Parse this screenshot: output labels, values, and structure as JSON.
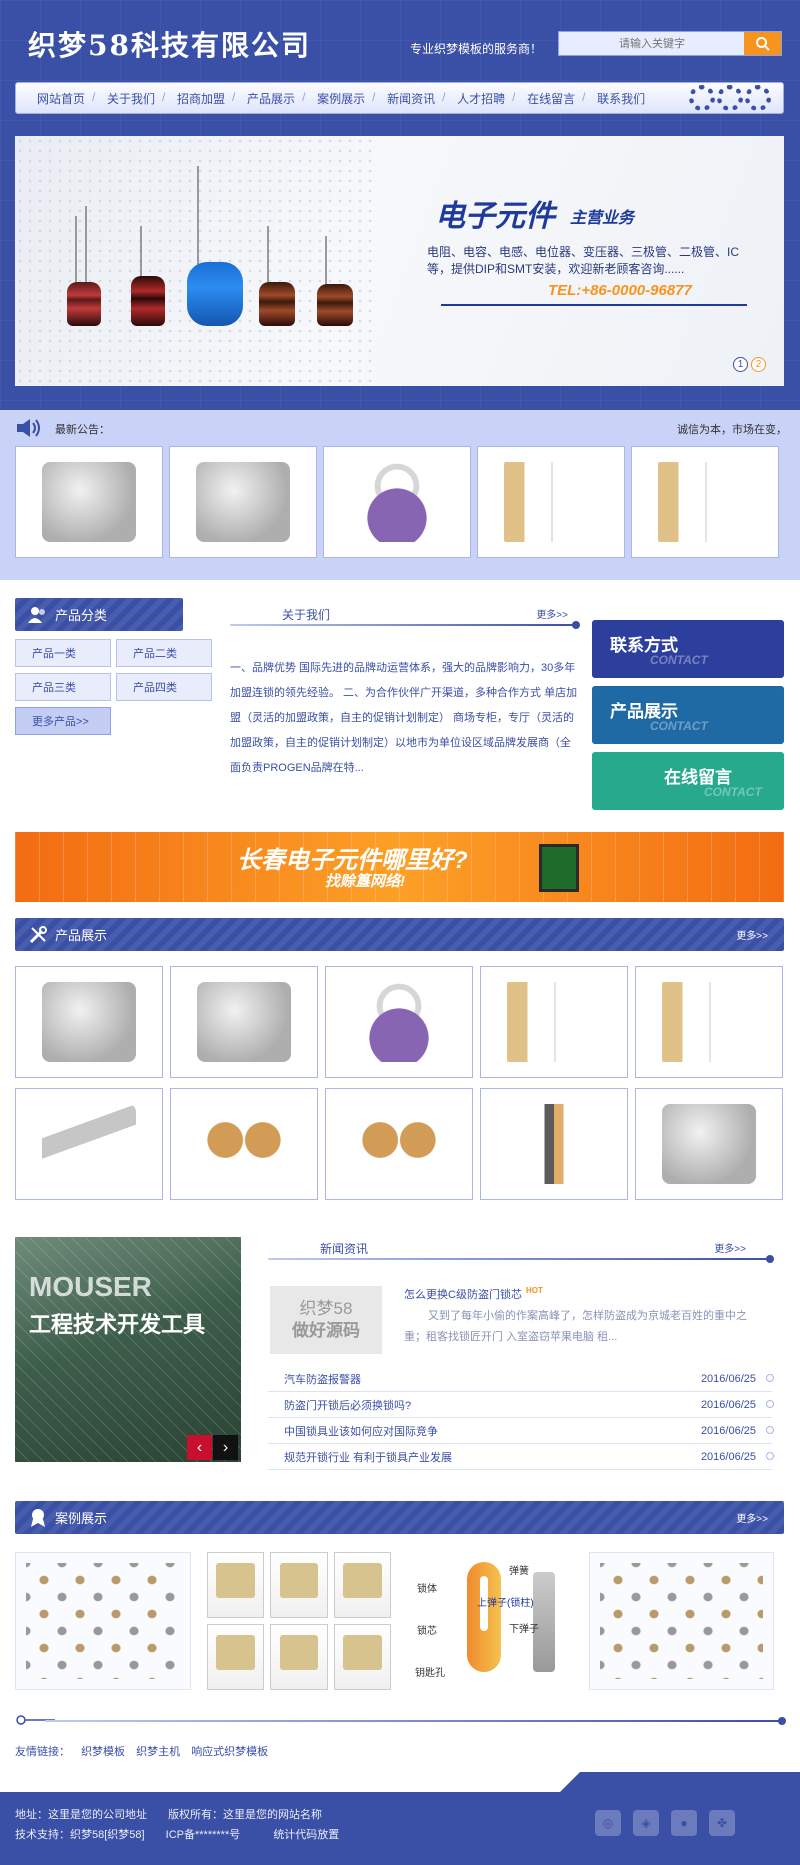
{
  "header": {
    "logo": "织梦58科技有限公司",
    "slogan": "专业织梦模板的服务商！",
    "search_placeholder": "请输入关键字"
  },
  "nav": [
    "网站首页",
    "关于我们",
    "招商加盟",
    "产品展示",
    "案例展示",
    "新闻资讯",
    "人才招聘",
    "在线留言",
    "联系我们"
  ],
  "banner": {
    "title": "电子元件",
    "subtitle": "主营业务",
    "text": "电阻、电容、电感、电位器、变压器、三极管、二极管、IC等，提供DIP和SMT安装，欢迎新老顾客咨询......",
    "tel": "TEL:+86-0000-96877",
    "dots": [
      "1",
      "2"
    ]
  },
  "notice": {
    "label": "最新公告：",
    "marquee": "诚信为本，市场在变，诚"
  },
  "product_category": {
    "title": "产品分类",
    "items": [
      "产品一类",
      "产品二类",
      "产品三类",
      "产品四类"
    ],
    "more": "更多产品>>"
  },
  "about": {
    "title": "关于我们",
    "more": "更多>>",
    "text": "一、品牌优势 国际先进的品牌动运营体系，强大的品牌影响力，30多年加盟连锁的领先经验。 二、为合作伙伴广开渠道，多种合作方式 单店加盟（灵活的加盟政策，自主的促销计划制定） 商场专柜，专厅（灵活的加盟政策，自主的促销计划制定）以地市为单位设区域品牌发展商（全面负责PROGEN品牌在特..."
  },
  "cta": [
    {
      "label": "联系方式",
      "en": "CONTACT",
      "color": "#2c3f9c"
    },
    {
      "label": "产品展示",
      "en": "CONTACT",
      "color": "#1f6aa5"
    },
    {
      "label": "在线留言",
      "en": "CONTACT",
      "color": "#26a98d"
    }
  ],
  "ad": {
    "line1": "长春电子元件哪里好?",
    "line2": "找赊簋网络!"
  },
  "products": {
    "title": "产品展示",
    "more": "更多>>"
  },
  "news": {
    "title": "新闻资讯",
    "more": "更多>>",
    "image_text1": "MOUSER",
    "image_text2": "工程技术开发工具",
    "feature_img_line1": "织梦58",
    "feature_img_line2": "做好源码",
    "feature_title": "怎么更换C级防盗门锁芯",
    "hot": "HOT",
    "feature_desc": "又到了每年小偷的作案高峰了，怎样防盗成为京城老百姓的重中之重；租客找锁匠开门 入室盗窃苹果电脑 租...",
    "items": [
      {
        "title": "汽车防盗报警器",
        "date": "2016/06/25"
      },
      {
        "title": "防盗门开锁后必须换锁吗?",
        "date": "2016/06/25"
      },
      {
        "title": "中国锁具业该如何应对国际竞争",
        "date": "2016/06/25"
      },
      {
        "title": "规范开锁行业 有利于锁具产业发展",
        "date": "2016/06/25"
      }
    ]
  },
  "cases": {
    "title": "案例展示",
    "more": "更多>>",
    "diagram_labels": [
      "锁体",
      "弹簧",
      "上弹子(锁柱)",
      "锁芯",
      "下弹子",
      "钥匙孔"
    ]
  },
  "links": {
    "label": "友情链接：",
    "items": [
      "织梦模板",
      "织梦主机",
      "响应式织梦模板"
    ]
  },
  "footer": {
    "address": "地址：这里是您的公司地址",
    "copyright": "版权所有：这里是您的网站名称",
    "support": "技术支持：织梦58[织梦58]",
    "icp": "ICP备********号",
    "stats": "统计代码放置"
  },
  "colors": {
    "primary": "#3a4fa6",
    "accent": "#f7941d",
    "light": "#c9d2f7"
  }
}
